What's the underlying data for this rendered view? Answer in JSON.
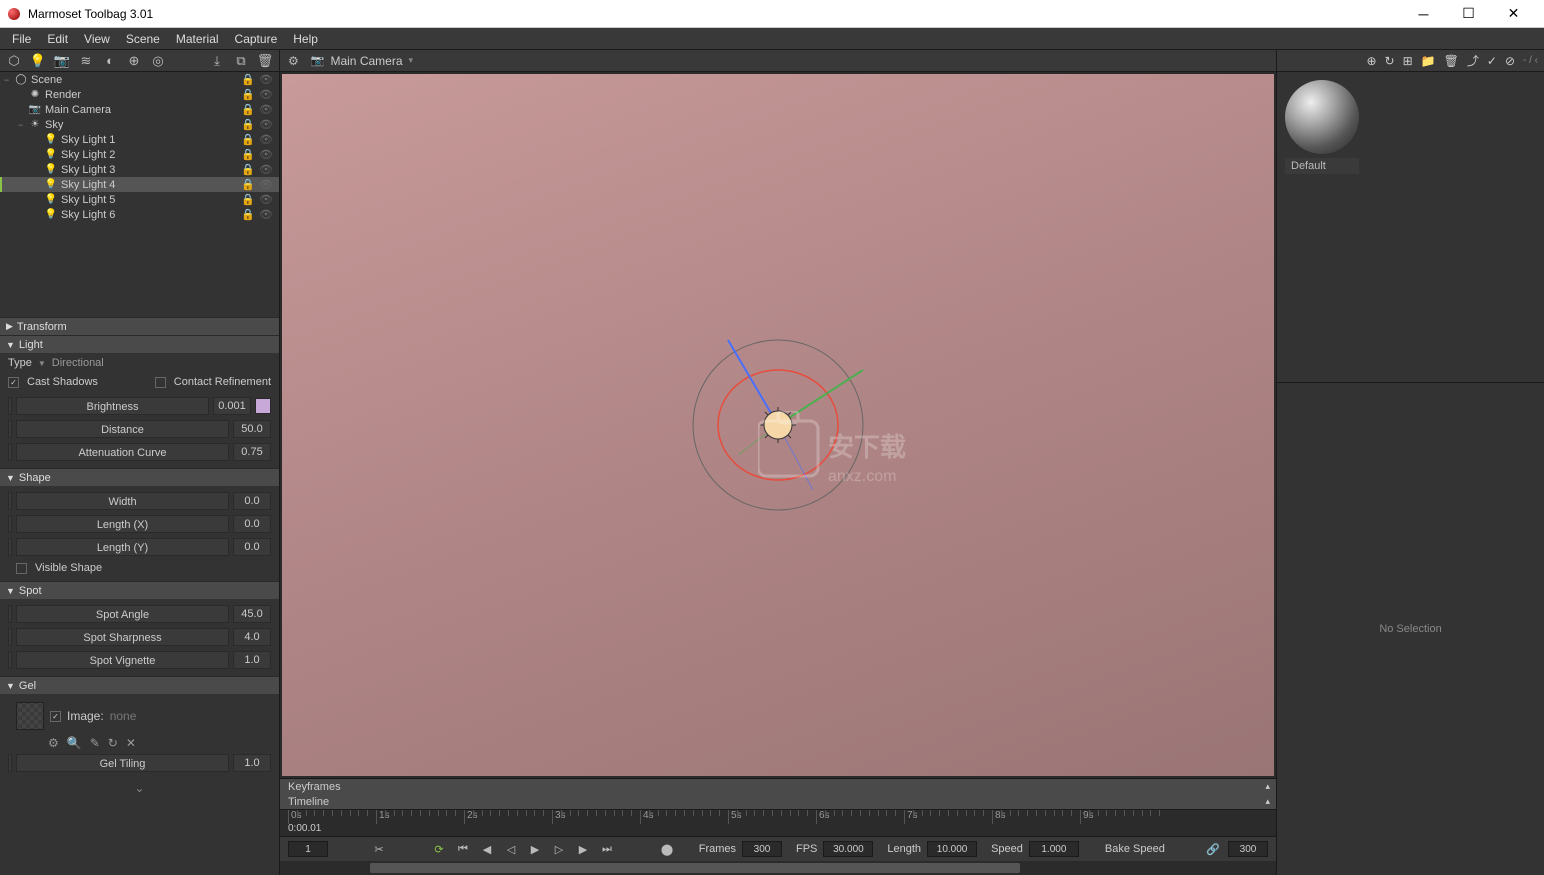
{
  "window": {
    "title": "Marmoset Toolbag 3.01"
  },
  "menubar": [
    "File",
    "Edit",
    "View",
    "Scene",
    "Material",
    "Capture",
    "Help"
  ],
  "viewport": {
    "camera_label": "Main Camera",
    "dropdown_arrow": "▾"
  },
  "scene_tree": [
    {
      "label": "Scene",
      "indent": 0,
      "icon": "◯",
      "expand": "−"
    },
    {
      "label": "Render",
      "indent": 1,
      "icon": "✺"
    },
    {
      "label": "Main Camera",
      "indent": 1,
      "icon": "📷"
    },
    {
      "label": "Sky",
      "indent": 1,
      "icon": "☀",
      "expand": "−"
    },
    {
      "label": "Sky Light 1",
      "indent": 2,
      "icon": "💡"
    },
    {
      "label": "Sky Light 2",
      "indent": 2,
      "icon": "💡"
    },
    {
      "label": "Sky Light 3",
      "indent": 2,
      "icon": "💡"
    },
    {
      "label": "Sky Light 4",
      "indent": 2,
      "icon": "💡",
      "selected": true
    },
    {
      "label": "Sky Light 5",
      "indent": 2,
      "icon": "💡"
    },
    {
      "label": "Sky Light 6",
      "indent": 2,
      "icon": "💡"
    }
  ],
  "panels": {
    "transform": {
      "title": "Transform",
      "collapsed": true
    },
    "light": {
      "title": "Light",
      "type_label": "Type",
      "type_value": "Directional",
      "cast_shadows": "Cast Shadows",
      "contact_refinement": "Contact Refinement",
      "brightness": {
        "label": "Brightness",
        "value": "0.001"
      },
      "distance": {
        "label": "Distance",
        "value": "50.0"
      },
      "attenuation": {
        "label": "Attenuation Curve",
        "value": "0.75"
      }
    },
    "shape": {
      "title": "Shape",
      "width": {
        "label": "Width",
        "value": "0.0"
      },
      "length_x": {
        "label": "Length (X)",
        "value": "0.0"
      },
      "length_y": {
        "label": "Length (Y)",
        "value": "0.0"
      },
      "visible_shape": "Visible Shape"
    },
    "spot": {
      "title": "Spot",
      "angle": {
        "label": "Spot Angle",
        "value": "45.0"
      },
      "sharpness": {
        "label": "Spot Sharpness",
        "value": "4.0"
      },
      "vignette": {
        "label": "Spot Vignette",
        "value": "1.0"
      }
    },
    "gel": {
      "title": "Gel",
      "image_label": "Image:",
      "image_value": "none",
      "tiling": {
        "label": "Gel Tiling",
        "value": "1.0"
      }
    }
  },
  "timeline": {
    "keyframes_label": "Keyframes",
    "timeline_label": "Timeline",
    "markers": [
      "0s",
      "1s",
      "2s",
      "3s",
      "4s",
      "5s",
      "6s",
      "7s",
      "8s",
      "9s"
    ],
    "playhead": "0:00.01",
    "current_frame": "1",
    "frames": {
      "label": "Frames",
      "value": "300"
    },
    "fps": {
      "label": "FPS",
      "value": "30.000"
    },
    "length": {
      "label": "Length",
      "value": "10.000"
    },
    "speed": {
      "label": "Speed",
      "value": "1.000"
    },
    "bake_speed": "Bake Speed",
    "bake_value": "300"
  },
  "right": {
    "material_label": "Default",
    "no_selection": "No Selection",
    "toolbar_suffix": "- / ‹"
  }
}
